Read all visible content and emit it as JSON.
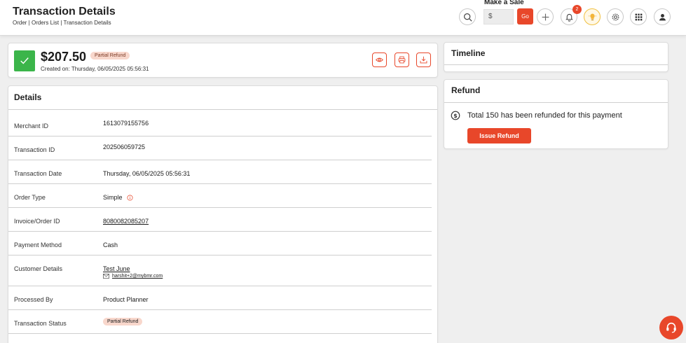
{
  "header": {
    "title": "Transaction Details",
    "breadcrumb": "Order | Orders List | Transaction Details",
    "make_sale_label": "Make a Sale",
    "sale_input_placeholder": "$",
    "go_label": "Go",
    "notification_count": "2"
  },
  "summary": {
    "amount": "$207.50",
    "status_pill": "Partial Refund",
    "created": "Created on: Thursday, 06/05/2025 05:56:31"
  },
  "details": {
    "title": "Details",
    "rows": [
      {
        "label": "Merchant ID",
        "value": "1613079155756"
      },
      {
        "label": "Transaction ID",
        "value": "202506059725"
      },
      {
        "label": "Transaction Date",
        "value": "Thursday, 06/05/2025 05:56:31"
      },
      {
        "label": "Order Type",
        "value": "Simple"
      },
      {
        "label": "Invoice/Order ID",
        "value": "8080082085207"
      },
      {
        "label": "Payment Method",
        "value": "Cash"
      },
      {
        "label": "Customer Details",
        "value": "Test June",
        "email": "harshit+2@mybmr.com"
      },
      {
        "label": "Processed By",
        "value": "Product Planner"
      },
      {
        "label": "Transaction Status",
        "value": "Partial Refund"
      }
    ]
  },
  "timeline": {
    "title": "Timeline"
  },
  "refund": {
    "title": "Refund",
    "message": "Total 150 has been refunded for this payment",
    "button_label": "Issue Refund"
  },
  "colors": {
    "accent": "#e8472a",
    "success": "#3bb54a",
    "pill_bg": "#f8d7cc"
  },
  "icons": [
    "search-icon",
    "plus-icon",
    "bell-icon",
    "lightbulb-icon",
    "gear-icon",
    "apps-grid-icon",
    "user-icon",
    "check-icon",
    "eye-icon",
    "print-icon",
    "download-icon",
    "info-icon",
    "mail-icon",
    "dollar-circle-icon",
    "headset-icon"
  ]
}
